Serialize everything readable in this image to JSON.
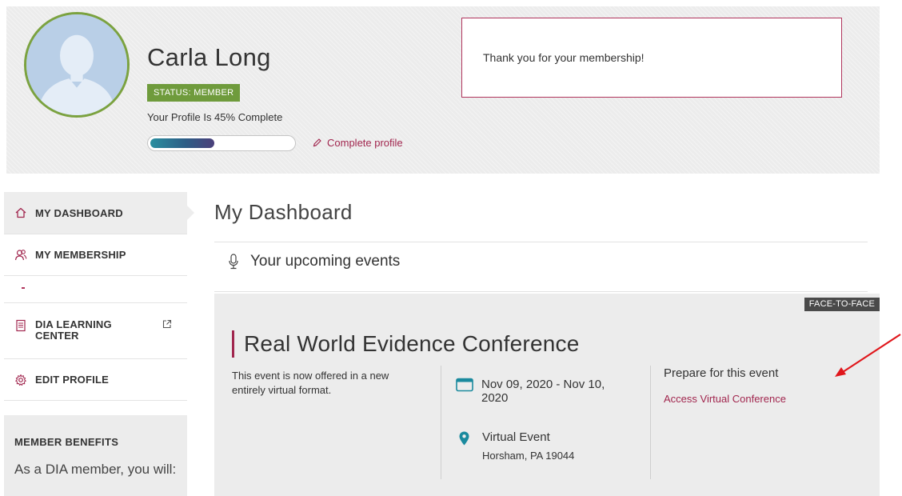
{
  "profile": {
    "name": "Carla Long",
    "status": "STATUS: MEMBER",
    "completion_text": "Your Profile Is 45% Complete",
    "completion_percent": 45,
    "complete_link": "Complete profile"
  },
  "notice": {
    "text": "Thank you for your membership!"
  },
  "sidebar": {
    "items": [
      {
        "label": "MY DASHBOARD",
        "icon": "home-icon",
        "active": true
      },
      {
        "label": "MY MEMBERSHIP",
        "icon": "members-icon"
      },
      {
        "label": "DIA LEARNING CENTER",
        "icon": "document-icon",
        "external": true
      },
      {
        "label": "EDIT PROFILE",
        "icon": "gear-icon"
      }
    ],
    "benefits": {
      "title": "MEMBER BENEFITS",
      "text": "As a DIA member, you will:"
    }
  },
  "main": {
    "title": "My Dashboard",
    "section_title": "Your upcoming events",
    "section_icon": "microphone-icon"
  },
  "event": {
    "type": "FACE-TO-FACE",
    "title": "Real World Evidence Conference",
    "description": "This event is now offered in a new entirely virtual format.",
    "dates": "Nov 09, 2020 - Nov 10, 2020",
    "location_name": "Virtual Event",
    "location_address": "Horsham, PA 19044",
    "prepare_title": "Prepare for this event",
    "access_link": "Access Virtual Conference"
  },
  "colors": {
    "accent": "#a1264e",
    "status_green": "#6f9b3c",
    "teal": "#1a8a9e",
    "annotation_red": "#e0161b"
  }
}
